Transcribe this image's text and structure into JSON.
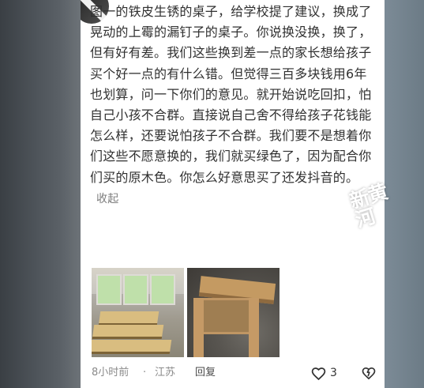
{
  "comment": {
    "text": "图一的铁皮生锈的桌子，给学校提了建议，换成了晃动的上霉的漏钉子的桌子。你说换没换，换了，但有好有差。我们这些换到差一点的家长想给孩子买个好一点的有什么错。但觉得三百多块钱用6年也划算，问一下你们的意见。就开始说吃回扣，怕自己小孩不合群。直接说自己舍不得给孩子花钱能怎么样，还要说怕孩子不合群。我们要不是想着你们这些不愿意换的，我们就买绿色了，因为配合你们买的原木色。你怎么好意思买了还发抖音的。",
    "collapse_label": "收起"
  },
  "meta": {
    "time": "8小时前",
    "separator": "·",
    "location": "江苏",
    "reply_label": "回复",
    "like_count": "3"
  },
  "icons": {
    "like": "heart-outline-icon",
    "dislike": "broken-heart-icon"
  },
  "watermark": {
    "text": "新黄河"
  },
  "colors": {
    "text": "#303030",
    "secondary": "#8a8a8a"
  }
}
